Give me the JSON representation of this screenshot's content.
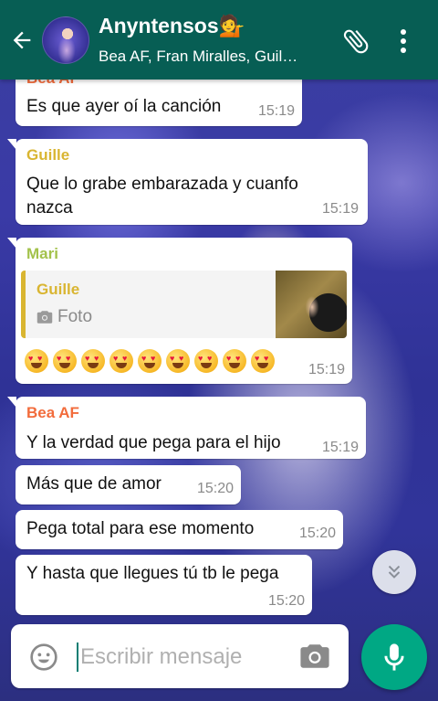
{
  "colors": {
    "header": "#075e54",
    "bubble": "#ffffff",
    "sender_bea": "#f26c3c",
    "sender_guille": "#d9b531",
    "sender_mari": "#a3c24b",
    "mic_button": "#00a884",
    "time_text": "#8a8a8a"
  },
  "header": {
    "title": "Anyntensos💁",
    "subtitle": "Bea AF, Fran Miralles, Guil…",
    "icons": [
      "back-arrow-icon",
      "group-avatar",
      "paperclip-icon",
      "more-vert-icon"
    ]
  },
  "messages": [
    {
      "sender": "Bea AF",
      "text": "Es que ayer oí la canción",
      "time": "15:19"
    },
    {
      "sender": "Guille",
      "text": "Que lo grabe embarazada y cuanfo nazca",
      "time": "15:19"
    },
    {
      "sender": "Mari",
      "quote": {
        "sender": "Guille",
        "label": "Foto",
        "icon": "camera-icon"
      },
      "text": "😍😍😍😍😍😍😍😍😍",
      "time": "15:19"
    },
    {
      "sender": "Bea AF",
      "text": "Y la verdad que pega para el hijo",
      "time": "15:19"
    },
    {
      "text": "Más que de amor",
      "time": "15:20"
    },
    {
      "text": "Pega total para ese momento",
      "time": "15:20"
    },
    {
      "text": "Y hasta que llegues tú tb le pega",
      "time": "15:20"
    }
  ],
  "input": {
    "placeholder": "Escribir mensaje",
    "icons": [
      "emoji-icon",
      "camera-icon",
      "mic-icon"
    ]
  }
}
